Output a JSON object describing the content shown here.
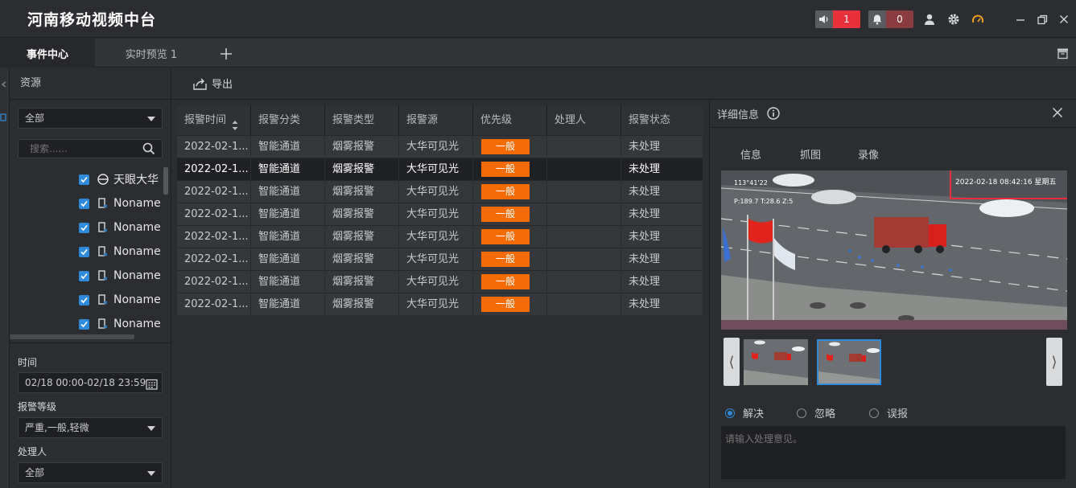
{
  "app": {
    "title": "河南移动视频中台",
    "sound_count": "1",
    "bell_count": "0"
  },
  "tabs": [
    {
      "label": "事件中心"
    },
    {
      "label": "实时预览 1"
    }
  ],
  "resource": {
    "header": "资源",
    "filter_value": "全部",
    "search_placeholder": "搜索......",
    "tree": [
      {
        "label": "天眼大华",
        "kind": "org"
      },
      {
        "label": "Noname",
        "kind": "camera"
      },
      {
        "label": "Noname",
        "kind": "camera"
      },
      {
        "label": "Noname",
        "kind": "camera"
      },
      {
        "label": "Noname",
        "kind": "camera"
      },
      {
        "label": "Noname",
        "kind": "camera"
      },
      {
        "label": "Noname",
        "kind": "camera"
      }
    ]
  },
  "filters": {
    "time_label": "时间",
    "time_value": "02/18 00:00-02/18 23:59",
    "level_label": "报警等级",
    "level_value": "严重,一般,轻微",
    "handler_label": "处理人",
    "handler_value": "全部"
  },
  "toolbar": {
    "export_label": "导出"
  },
  "table": {
    "columns": [
      "报警时间",
      "报警分类",
      "报警类型",
      "报警源",
      "优先级",
      "处理人",
      "报警状态"
    ],
    "rows": [
      {
        "time": "2022-02-1...",
        "category": "智能通道",
        "type": "烟雾报警",
        "source": "大华可见光",
        "priority": "一般",
        "handler": "",
        "status": "未处理"
      },
      {
        "time": "2022-02-1...",
        "category": "智能通道",
        "type": "烟雾报警",
        "source": "大华可见光",
        "priority": "一般",
        "handler": "",
        "status": "未处理"
      },
      {
        "time": "2022-02-1...",
        "category": "智能通道",
        "type": "烟雾报警",
        "source": "大华可见光",
        "priority": "一般",
        "handler": "",
        "status": "未处理"
      },
      {
        "time": "2022-02-1...",
        "category": "智能通道",
        "type": "烟雾报警",
        "source": "大华可见光",
        "priority": "一般",
        "handler": "",
        "status": "未处理"
      },
      {
        "time": "2022-02-1...",
        "category": "智能通道",
        "type": "烟雾报警",
        "source": "大华可见光",
        "priority": "一般",
        "handler": "",
        "status": "未处理"
      },
      {
        "time": "2022-02-1...",
        "category": "智能通道",
        "type": "烟雾报警",
        "source": "大华可见光",
        "priority": "一般",
        "handler": "",
        "status": "未处理"
      },
      {
        "time": "2022-02-1...",
        "category": "智能通道",
        "type": "烟雾报警",
        "source": "大华可见光",
        "priority": "一般",
        "handler": "",
        "status": "未处理"
      },
      {
        "time": "2022-02-1...",
        "category": "智能通道",
        "type": "烟雾报警",
        "source": "大华可见光",
        "priority": "一般",
        "handler": "",
        "status": "未处理"
      }
    ],
    "selected_row": 1
  },
  "detail": {
    "header": "详细信息",
    "subtabs": [
      "信息",
      "抓图",
      "录像"
    ],
    "timestamp": "2022-02-18 08:42:16 星期五",
    "osd_coords": "113°41'22",
    "osd_ptz": "P:189.7 T:28.6 Z:5",
    "actions": [
      "解决",
      "忽略",
      "误报"
    ],
    "selected_action": 0,
    "comment_placeholder": "请输入处理意见。"
  },
  "colors": {
    "accent": "#2e8bdc",
    "priority": "#f26b05",
    "alert_red": "#e8303a",
    "highlight_box": "#e8303a"
  }
}
